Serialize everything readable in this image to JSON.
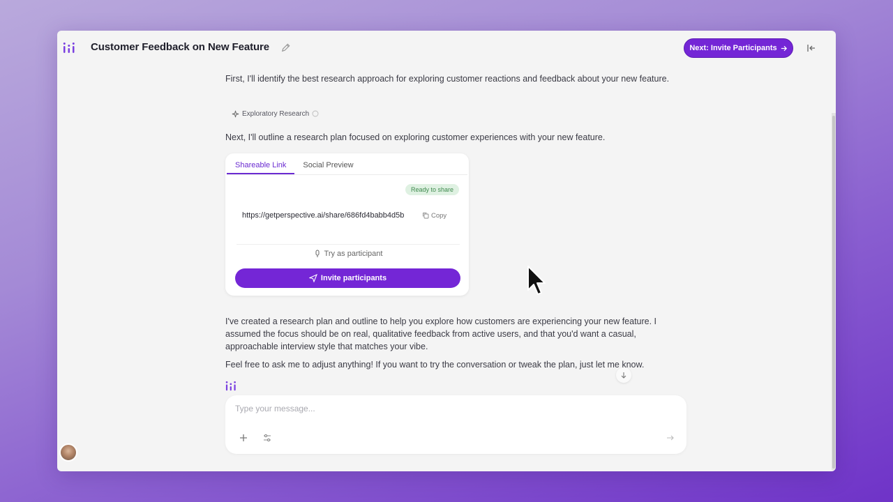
{
  "header": {
    "title": "Customer Feedback on New Feature",
    "next_button_label": "Next: Invite Participants",
    "accent_color": "#7426d6"
  },
  "chat": {
    "message_1": "First, I'll identify the best research approach for exploring customer reactions and feedback about your new feature.",
    "approach_chip": "Exploratory Research",
    "message_2": "Next, I'll outline a research plan focused on exploring customer experiences with your new feature.",
    "share_card": {
      "tabs": [
        {
          "label": "Shareable Link",
          "active": true
        },
        {
          "label": "Social Preview",
          "active": false
        }
      ],
      "status_badge": "Ready to share",
      "link": "https://getperspective.ai/share/686fd4babb4d5b",
      "copy_label": "Copy",
      "try_label": "Try as participant",
      "invite_label": "Invite participants"
    },
    "message_3": "I've created a research plan and outline to help you explore how customers are experiencing your new feature. I assumed the focus should be on real, qualitative feedback from active users, and that you'd want a casual, approachable interview style that matches your vibe.",
    "message_4": "Feel free to ask me to adjust anything! If you want to try the conversation or tweak the plan, just let me know."
  },
  "composer": {
    "placeholder": "Type your message..."
  },
  "icons": [
    "logo-icon",
    "edit-icon",
    "arrow-right-icon",
    "collapse-icon",
    "sparkle-icon",
    "info-icon",
    "copy-icon",
    "mic-icon",
    "send-icon",
    "plus-icon",
    "sliders-icon",
    "arrow-down-icon"
  ]
}
